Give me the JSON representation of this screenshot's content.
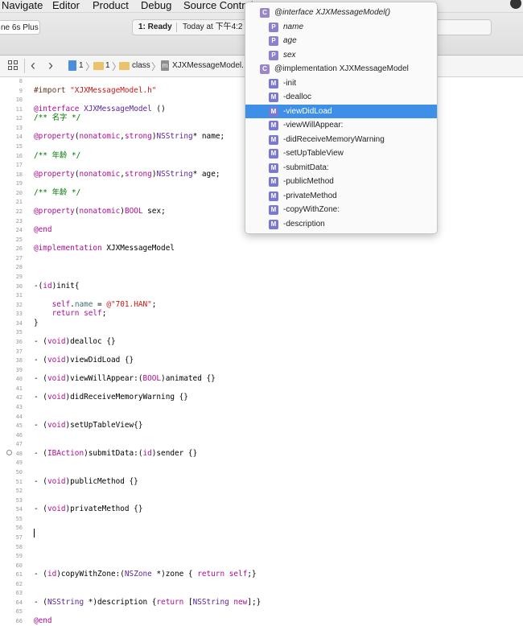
{
  "menu": [
    "Navigate",
    "Editor",
    "Product",
    "Debug",
    "Source Control"
  ],
  "toolbar": {
    "scheme": "ne 6s Plus",
    "status_state": "1: Ready",
    "status_time": "Today at 下午4:2"
  },
  "jumpbar": {
    "crumbs": [
      "1",
      "1",
      "class",
      "XJXMessageModel."
    ]
  },
  "popup": {
    "items": [
      {
        "kind": "C",
        "label": "@interface XJXMessageModel()",
        "italic": true,
        "indent": 0
      },
      {
        "kind": "P",
        "label": "name",
        "italic": true,
        "indent": 1
      },
      {
        "kind": "P",
        "label": "age",
        "italic": true,
        "indent": 1
      },
      {
        "kind": "P",
        "label": "sex",
        "italic": true,
        "indent": 1
      },
      {
        "kind": "C",
        "label": "@implementation XJXMessageModel",
        "italic": false,
        "indent": 0
      },
      {
        "kind": "M",
        "label": "-init",
        "italic": false,
        "indent": 1
      },
      {
        "kind": "M",
        "label": "-dealloc",
        "italic": false,
        "indent": 1
      },
      {
        "kind": "M",
        "label": "-viewDidLoad",
        "italic": false,
        "indent": 1,
        "selected": true
      },
      {
        "kind": "M",
        "label": "-viewWillAppear:",
        "italic": false,
        "indent": 1
      },
      {
        "kind": "M",
        "label": "-didReceiveMemoryWarning",
        "italic": false,
        "indent": 1
      },
      {
        "kind": "M",
        "label": "-setUpTableView",
        "italic": false,
        "indent": 1
      },
      {
        "kind": "M",
        "label": "-submitData:",
        "italic": false,
        "indent": 1
      },
      {
        "kind": "M",
        "label": "-publicMethod",
        "italic": false,
        "indent": 1
      },
      {
        "kind": "M",
        "label": "-privateMethod",
        "italic": false,
        "indent": 1
      },
      {
        "kind": "M",
        "label": "-copyWithZone:",
        "italic": false,
        "indent": 1
      },
      {
        "kind": "M",
        "label": "-description",
        "italic": false,
        "indent": 1
      }
    ]
  },
  "editor": {
    "line_numbers": [
      "8",
      "9",
      "10",
      "11",
      "12",
      "13",
      "14",
      "15",
      "16",
      "17",
      "18",
      "19",
      "20",
      "21",
      "22",
      "23",
      "24",
      "25",
      "26",
      "27",
      "28",
      "29",
      "30",
      "31",
      "32",
      "33",
      "34",
      "35",
      "36",
      "37",
      "38",
      "39",
      "40",
      "41",
      "42",
      "43",
      "44",
      "45",
      "46",
      "47",
      "48",
      "49",
      "50",
      "51",
      "52",
      "53",
      "54",
      "55",
      "56",
      "57",
      "58",
      "59",
      "60",
      "61",
      "62",
      "63",
      "64",
      "65",
      "66"
    ],
    "code_lines": [
      {
        "n": "9",
        "segs": [
          [
            "pre",
            "#import "
          ],
          [
            "str",
            "\"XJXMessageModel.h\""
          ]
        ]
      },
      {
        "n": "11",
        "segs": [
          [
            "kw",
            "@interface"
          ],
          [
            "",
            " "
          ],
          [
            "type",
            "XJXMessageModel"
          ],
          [
            "",
            " ()"
          ]
        ]
      },
      {
        "n": "12",
        "segs": [
          [
            "cmt",
            "/** 名字 */"
          ]
        ]
      },
      {
        "n": "14",
        "segs": [
          [
            "kw",
            "@property"
          ],
          [
            "",
            "("
          ],
          [
            "kw",
            "nonatomic"
          ],
          [
            "",
            ","
          ],
          [
            "kw",
            "strong"
          ],
          [
            "",
            ")"
          ],
          [
            "type",
            "NSString"
          ],
          [
            "",
            "* name;"
          ]
        ]
      },
      {
        "n": "16",
        "segs": [
          [
            "cmt",
            "/** 年龄 */"
          ]
        ]
      },
      {
        "n": "18",
        "segs": [
          [
            "kw",
            "@property"
          ],
          [
            "",
            "("
          ],
          [
            "kw",
            "nonatomic"
          ],
          [
            "",
            ","
          ],
          [
            "kw",
            "strong"
          ],
          [
            "",
            ")"
          ],
          [
            "type",
            "NSString"
          ],
          [
            "",
            "* age;"
          ]
        ]
      },
      {
        "n": "20",
        "segs": [
          [
            "cmt",
            "/** 年龄 */"
          ]
        ]
      },
      {
        "n": "22",
        "segs": [
          [
            "kw",
            "@property"
          ],
          [
            "",
            "("
          ],
          [
            "kw",
            "nonatomic"
          ],
          [
            "",
            ")"
          ],
          [
            "kw",
            "BOOL"
          ],
          [
            "",
            " sex;"
          ]
        ]
      },
      {
        "n": "24",
        "segs": [
          [
            "kw",
            "@end"
          ]
        ]
      },
      {
        "n": "26",
        "segs": [
          [
            "kw",
            "@implementation"
          ],
          [
            "",
            " XJXMessageModel"
          ]
        ]
      },
      {
        "n": "30",
        "segs": [
          [
            "",
            "-("
          ],
          [
            "kw",
            "id"
          ],
          [
            "",
            ")init{"
          ]
        ]
      },
      {
        "n": "32",
        "segs": [
          [
            "",
            "    "
          ],
          [
            "kw",
            "self"
          ],
          [
            "",
            "."
          ],
          [
            "attr",
            "name"
          ],
          [
            "",
            " = "
          ],
          [
            "str",
            "@\"701.HAN\""
          ],
          [
            "",
            ";"
          ]
        ]
      },
      {
        "n": "33",
        "segs": [
          [
            "",
            "    "
          ],
          [
            "kw",
            "return"
          ],
          [
            "",
            " "
          ],
          [
            "kw",
            "self"
          ],
          [
            "",
            ";"
          ]
        ]
      },
      {
        "n": "34",
        "segs": [
          [
            "",
            "}"
          ]
        ]
      },
      {
        "n": "36",
        "segs": [
          [
            "",
            "- ("
          ],
          [
            "kw",
            "void"
          ],
          [
            "",
            ")dealloc {}"
          ]
        ]
      },
      {
        "n": "38",
        "segs": [
          [
            "",
            "- ("
          ],
          [
            "kw",
            "void"
          ],
          [
            "",
            ")viewDidLoad {}"
          ]
        ]
      },
      {
        "n": "40",
        "segs": [
          [
            "",
            "- ("
          ],
          [
            "kw",
            "void"
          ],
          [
            "",
            ")viewWillAppear:("
          ],
          [
            "kw",
            "BOOL"
          ],
          [
            "",
            ")animated {}"
          ]
        ]
      },
      {
        "n": "42",
        "segs": [
          [
            "",
            "- ("
          ],
          [
            "kw",
            "void"
          ],
          [
            "",
            ")didReceiveMemoryWarning {}"
          ]
        ]
      },
      {
        "n": "45",
        "segs": [
          [
            "",
            "- ("
          ],
          [
            "kw",
            "void"
          ],
          [
            "",
            ")setUpTableView{}"
          ]
        ]
      },
      {
        "n": "48",
        "segs": [
          [
            "",
            "- ("
          ],
          [
            "kw",
            "IBAction"
          ],
          [
            "",
            ")submitData:("
          ],
          [
            "kw",
            "id"
          ],
          [
            "",
            ")sender {}"
          ]
        ]
      },
      {
        "n": "51",
        "segs": [
          [
            "",
            "- ("
          ],
          [
            "kw",
            "void"
          ],
          [
            "",
            ")publicMethod {}"
          ]
        ]
      },
      {
        "n": "54",
        "segs": [
          [
            "",
            "- ("
          ],
          [
            "kw",
            "void"
          ],
          [
            "",
            ")privateMethod {}"
          ]
        ]
      },
      {
        "n": "61",
        "segs": [
          [
            "",
            "- ("
          ],
          [
            "kw",
            "id"
          ],
          [
            "",
            ")copyWithZone:("
          ],
          [
            "type",
            "NSZone"
          ],
          [
            "",
            " *)zone { "
          ],
          [
            "kw",
            "return"
          ],
          [
            "",
            " "
          ],
          [
            "kw",
            "self"
          ],
          [
            "",
            ";}"
          ]
        ]
      },
      {
        "n": "64",
        "segs": [
          [
            "",
            "- ("
          ],
          [
            "type",
            "NSString"
          ],
          [
            "",
            " *)description {"
          ],
          [
            "kw",
            "return"
          ],
          [
            "",
            " ["
          ],
          [
            "type",
            "NSString"
          ],
          [
            "",
            " "
          ],
          [
            "kw",
            "new"
          ],
          [
            "",
            "];}"
          ]
        ]
      },
      {
        "n": "66",
        "segs": [
          [
            "kw",
            "@end"
          ]
        ]
      }
    ],
    "colors": {
      "keyword": "#aa0d91",
      "type": "#5c2699",
      "string": "#c41a16",
      "comment": "#007400",
      "preprocessor": "#643820"
    }
  }
}
